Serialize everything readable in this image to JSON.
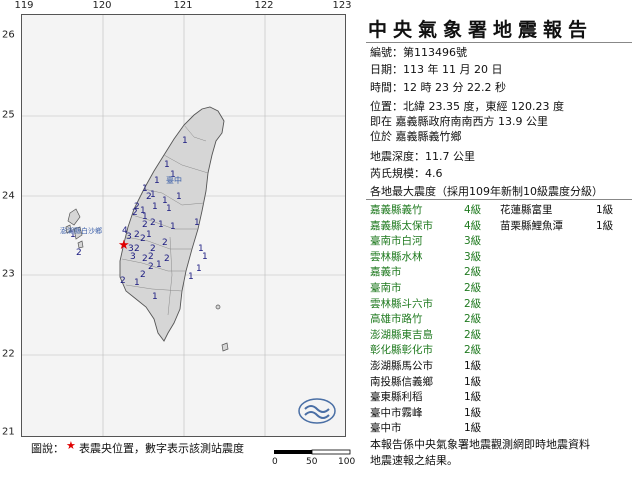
{
  "map": {
    "lon_labels": [
      "119",
      "120",
      "121",
      "122",
      "123"
    ],
    "lat_labels": [
      "26",
      "25",
      "24",
      "23",
      "22",
      "21"
    ],
    "place_labels": [
      "臺中",
      "澎湖縣白沙鄉"
    ],
    "station_intensities": [
      "1",
      "1",
      "1",
      "2",
      "1",
      "2",
      "2",
      "1",
      "1",
      "2",
      "2",
      "1",
      "4",
      "3",
      "2",
      "2",
      "1",
      "3",
      "2",
      "3",
      "2",
      "2",
      "2",
      "1",
      "2",
      "1",
      "1",
      "1",
      "2",
      "2",
      "2",
      "1",
      "1",
      "2",
      "2",
      "1",
      "1",
      "1",
      "1",
      "1",
      "1",
      "1",
      "1",
      "1",
      "1"
    ],
    "epicenter_symbol": "red-star",
    "colors": {
      "land": "#d8d8d8",
      "sea": "#f4f4f4",
      "coast": "#555555",
      "epicenter": "#e00000",
      "logo": "#4a6fa5"
    }
  },
  "report": {
    "title": "中央氣象署地震報告",
    "number_label": "編號：",
    "number_value": "第113496號",
    "date_label": "日期：",
    "date_value": "113 年 11 月 20 日",
    "time_label": "時間：",
    "time_value": "12 時 23 分 22.2 秒",
    "position_label": "位置：",
    "position_value": "北緯 23.35 度，東經 120.23 度",
    "position_line2": "即在 嘉義縣政府南南西方 13.9 公里",
    "position_line3": "位於 嘉義縣義竹鄉",
    "depth_label": "地震深度：",
    "depth_value": "11.7 公里",
    "magnitude_label": "芮氏規模：",
    "magnitude_value": "4.6",
    "intensity_header": "各地最大震度（採用109年新制10級震度分級）"
  },
  "intensities": [
    {
      "loc": "嘉義縣義竹",
      "level": "4級",
      "color": "green"
    },
    {
      "loc": "嘉義縣太保市",
      "level": "4級",
      "color": "green"
    },
    {
      "loc": "臺南市白河",
      "level": "3級",
      "color": "green"
    },
    {
      "loc": "雲林縣水林",
      "level": "3級",
      "color": "green"
    },
    {
      "loc": "嘉義市",
      "level": "2級",
      "color": "green"
    },
    {
      "loc": "臺南市",
      "level": "2級",
      "color": "green"
    },
    {
      "loc": "雲林縣斗六市",
      "level": "2級",
      "color": "green"
    },
    {
      "loc": "高雄市路竹",
      "level": "2級",
      "color": "green"
    },
    {
      "loc": "澎湖縣東吉島",
      "level": "2級",
      "color": "green"
    },
    {
      "loc": "彰化縣彰化市",
      "level": "2級",
      "color": "green"
    },
    {
      "loc": "澎湖縣馬公市",
      "level": "1級",
      "color": "black"
    },
    {
      "loc": "南投縣信義鄉",
      "level": "1級",
      "color": "black"
    },
    {
      "loc": "臺東縣利稻",
      "level": "1級",
      "color": "black"
    },
    {
      "loc": "臺中市霧峰",
      "level": "1級",
      "color": "black"
    },
    {
      "loc": "臺中市",
      "level": "1級",
      "color": "black"
    }
  ],
  "intensities_right": [
    {
      "loc": "花蓮縣富里",
      "level": "1級",
      "color": "black"
    },
    {
      "loc": "苗栗縣鯉魚潭",
      "level": "1級",
      "color": "black"
    }
  ],
  "legend": {
    "prefix": "圖說：",
    "star_symbol": "★",
    "text": "表震央位置，數字表示該測站震度"
  },
  "scale": {
    "ticks": [
      "0",
      "50",
      "100"
    ]
  },
  "footer": {
    "line1": "本報告係中央氣象署地震觀測網即時地震資料",
    "line2": "地震速報之結果。"
  }
}
